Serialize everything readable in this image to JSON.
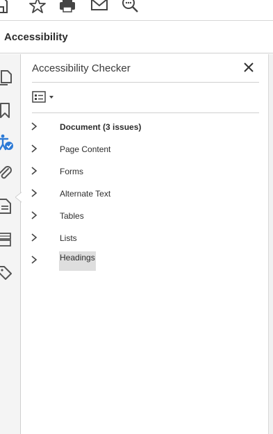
{
  "toolbar": {
    "icons": [
      "save-icon",
      "star-icon",
      "print-icon",
      "mail-icon",
      "search-icon"
    ]
  },
  "pane": {
    "title": "Accessibility"
  },
  "leftrail": {
    "icons": [
      "pages-icon",
      "bookmark-icon",
      "accessibility-icon",
      "attachment-icon",
      "document-icon",
      "layers-icon",
      "tags-icon"
    ]
  },
  "checker": {
    "title": "Accessibility Checker",
    "close_icon": "close-icon",
    "options_icon": "options-list-icon",
    "items": [
      {
        "label": "Document (3 issues)",
        "bold": true
      },
      {
        "label": "Page Content",
        "bold": false
      },
      {
        "label": "Forms",
        "bold": false
      },
      {
        "label": "Alternate Text",
        "bold": false
      },
      {
        "label": "Tables",
        "bold": false
      },
      {
        "label": "Lists",
        "bold": false
      },
      {
        "label": "Headings",
        "bold": false,
        "selected": true
      }
    ]
  },
  "colors": {
    "accent": "#2d7ad6",
    "text": "#2c2c2c",
    "selection": "#dedede"
  }
}
